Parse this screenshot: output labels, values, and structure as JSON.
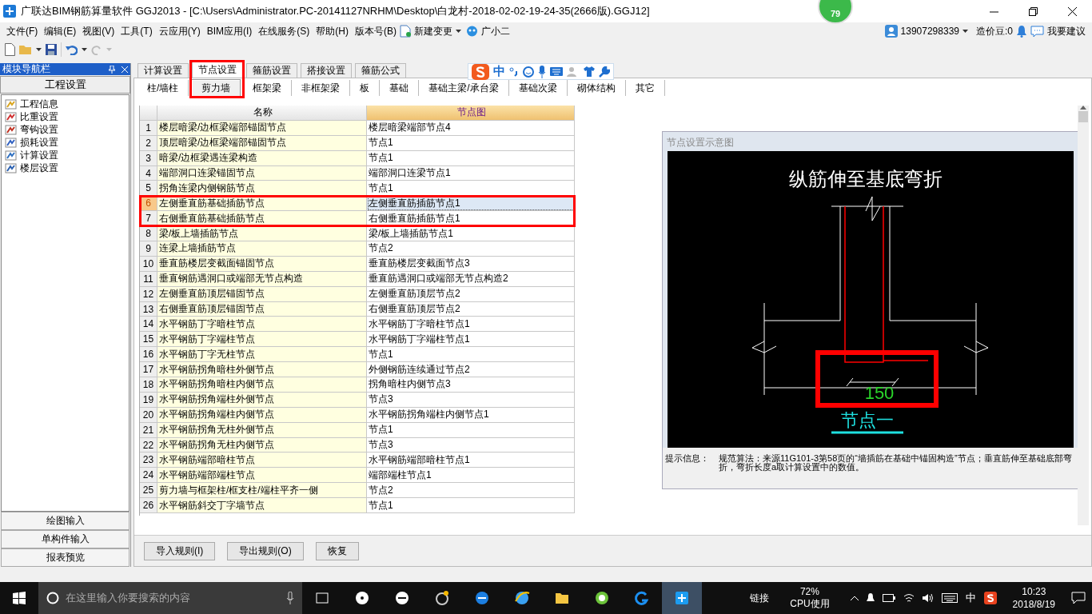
{
  "window": {
    "title": "广联达BIM钢筋算量软件 GGJ2013 - [C:\\Users\\Administrator.PC-20141127NRHM\\Desktop\\白龙村-2018-02-02-19-24-35(2666版).GGJ12]",
    "badge": "79"
  },
  "menu": {
    "items": [
      "文件(F)",
      "编辑(E)",
      "视图(V)",
      "工具(T)",
      "云应用(Y)",
      "BIM应用(I)",
      "在线服务(S)",
      "帮助(H)",
      "版本号(B)"
    ],
    "new_change": "新建变更",
    "assistant": "广小二"
  },
  "account": {
    "phone": "13907298339",
    "beans": "造价豆:0",
    "suggest": "我要建议"
  },
  "nav": {
    "title": "模块导航栏",
    "section": "工程设置",
    "items": [
      {
        "label": "工程信息"
      },
      {
        "label": "比重设置"
      },
      {
        "label": "弯钩设置"
      },
      {
        "label": "损耗设置"
      },
      {
        "label": "计算设置"
      },
      {
        "label": "楼层设置"
      }
    ],
    "bottom_buttons": [
      "绘图输入",
      "单构件输入",
      "报表预览"
    ]
  },
  "tabs": [
    {
      "label": "计算设置",
      "selected": false
    },
    {
      "label": "节点设置",
      "selected": true
    },
    {
      "label": "箍筋设置",
      "selected": false
    },
    {
      "label": "搭接设置",
      "selected": false
    },
    {
      "label": "箍筋公式",
      "selected": false
    }
  ],
  "subtabs": [
    {
      "label": "柱/墙柱",
      "selected": false
    },
    {
      "label": "剪力墙",
      "selected": true
    },
    {
      "label": "框架梁",
      "selected": false
    },
    {
      "label": "非框架梁",
      "selected": false
    },
    {
      "label": "板",
      "selected": false
    },
    {
      "label": "基础",
      "selected": false
    },
    {
      "label": "基础主梁/承台梁",
      "selected": false
    },
    {
      "label": "基础次梁",
      "selected": false
    },
    {
      "label": "砌体结构",
      "selected": false
    },
    {
      "label": "其它",
      "selected": false
    }
  ],
  "table": {
    "columns": [
      "名称",
      "节点图"
    ],
    "rows": [
      {
        "index": "1",
        "name": "楼层暗梁/边框梁端部锚固节点",
        "value": "楼层暗梁端部节点4",
        "selected": false
      },
      {
        "index": "2",
        "name": "顶层暗梁/边框梁端部锚固节点",
        "value": "节点1",
        "selected": false
      },
      {
        "index": "3",
        "name": "暗梁/边框梁遇连梁构造",
        "value": "节点1",
        "selected": false
      },
      {
        "index": "4",
        "name": "端部洞口连梁锚固节点",
        "value": "端部洞口连梁节点1",
        "selected": false
      },
      {
        "index": "5",
        "name": "拐角连梁内侧钢筋节点",
        "value": "节点1",
        "selected": false
      },
      {
        "index": "6",
        "name": "左侧垂直筋基础插筋节点",
        "value": "左侧垂直筋插筋节点1",
        "selected": true
      },
      {
        "index": "7",
        "name": "右侧垂直筋基础插筋节点",
        "value": "右侧垂直筋插筋节点1",
        "selected": false
      },
      {
        "index": "8",
        "name": "梁/板上墙插筋节点",
        "value": "梁/板上墙插筋节点1",
        "selected": false
      },
      {
        "index": "9",
        "name": "连梁上墙插筋节点",
        "value": "节点2",
        "selected": false
      },
      {
        "index": "10",
        "name": "垂直筋楼层变截面锚固节点",
        "value": "垂直筋楼层变截面节点3",
        "selected": false
      },
      {
        "index": "11",
        "name": "垂直钢筋遇洞口或端部无节点构造",
        "value": "垂直筋遇洞口或端部无节点构造2",
        "selected": false
      },
      {
        "index": "12",
        "name": "左侧垂直筋顶层锚固节点",
        "value": "左侧垂直筋顶层节点2",
        "selected": false
      },
      {
        "index": "13",
        "name": "右侧垂直筋顶层锚固节点",
        "value": "右侧垂直筋顶层节点2",
        "selected": false
      },
      {
        "index": "14",
        "name": "水平钢筋丁字暗柱节点",
        "value": "水平钢筋丁字暗柱节点1",
        "selected": false
      },
      {
        "index": "15",
        "name": "水平钢筋丁字端柱节点",
        "value": "水平钢筋丁字端柱节点1",
        "selected": false
      },
      {
        "index": "16",
        "name": "水平钢筋丁字无柱节点",
        "value": "节点1",
        "selected": false
      },
      {
        "index": "17",
        "name": "水平钢筋拐角暗柱外侧节点",
        "value": "外侧钢筋连续通过节点2",
        "selected": false
      },
      {
        "index": "18",
        "name": "水平钢筋拐角暗柱内侧节点",
        "value": "拐角暗柱内侧节点3",
        "selected": false
      },
      {
        "index": "19",
        "name": "水平钢筋拐角端柱外侧节点",
        "value": "节点3",
        "selected": false
      },
      {
        "index": "20",
        "name": "水平钢筋拐角端柱内侧节点",
        "value": "水平钢筋拐角端柱内侧节点1",
        "selected": false
      },
      {
        "index": "21",
        "name": "水平钢筋拐角无柱外侧节点",
        "value": "节点1",
        "selected": false
      },
      {
        "index": "22",
        "name": "水平钢筋拐角无柱内侧节点",
        "value": "节点3",
        "selected": false
      },
      {
        "index": "23",
        "name": "水平钢筋端部暗柱节点",
        "value": "水平钢筋端部暗柱节点1",
        "selected": false
      },
      {
        "index": "24",
        "name": "水平钢筋端部端柱节点",
        "value": "端部端柱节点1",
        "selected": false
      },
      {
        "index": "25",
        "name": "剪力墙与框架柱/框支柱/端柱平齐一侧",
        "value": "节点2",
        "selected": false
      },
      {
        "index": "26",
        "name": "水平钢筋斜交丁字墙节点",
        "value": "节点1",
        "selected": false
      }
    ]
  },
  "buttons": [
    "导入规则(I)",
    "导出规则(O)",
    "恢复"
  ],
  "diagram": {
    "title": "节点设置示意图",
    "caption": "纵筋伸至基底弯折",
    "dimension": "150",
    "node_label": "节点一",
    "hint_label": "提示信息：",
    "hint_text": "规范算法：来源11G101-3第58页的“墙插筋在基础中锚固构造”节点；垂直筋伸至基础底部弯折，弯折长度a取计算设置中的数值。"
  },
  "ime": {
    "label": "中"
  },
  "taskbar": {
    "search_placeholder": "在这里输入你要搜索的内容",
    "link": "链接",
    "cpu": "72%",
    "cpu_label": "CPU使用",
    "ime": "中",
    "time": "10:23",
    "date": "2018/8/19"
  }
}
